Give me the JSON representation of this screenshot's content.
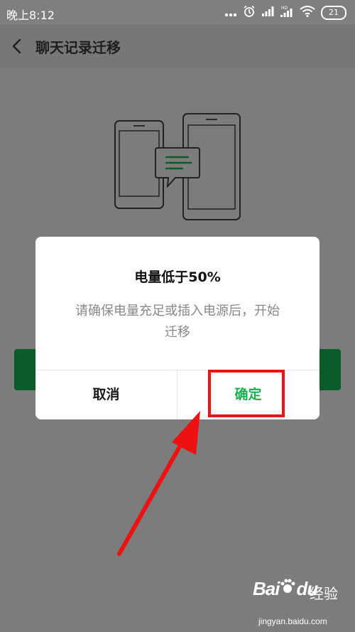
{
  "status_bar": {
    "time": "晚上8:12",
    "battery": "21",
    "icons": [
      "more-dots-icon",
      "alarm-icon",
      "signal-icon",
      "hd-signal-icon",
      "wifi-icon",
      "battery-icon"
    ]
  },
  "header": {
    "title": "聊天记录迁移",
    "back_icon": "chevron-left-icon"
  },
  "illustration": {
    "icons": [
      "phone-icon",
      "chat-bubble-icon",
      "tablet-icon"
    ],
    "accent_color": "#1aad52"
  },
  "dialog": {
    "title": "电量低于50%",
    "message_line1": "请确保电量充足或插入电源后，开始",
    "message_line2": "迁移",
    "cancel_label": "取消",
    "confirm_label": "确定"
  },
  "annotation": {
    "highlight_color": "#ee1111",
    "arrow_color": "#ee1111"
  },
  "watermark": {
    "logo": "Bai",
    "logo_suffix": "du",
    "text": "经验",
    "url": "jingyan.baidu.com"
  }
}
